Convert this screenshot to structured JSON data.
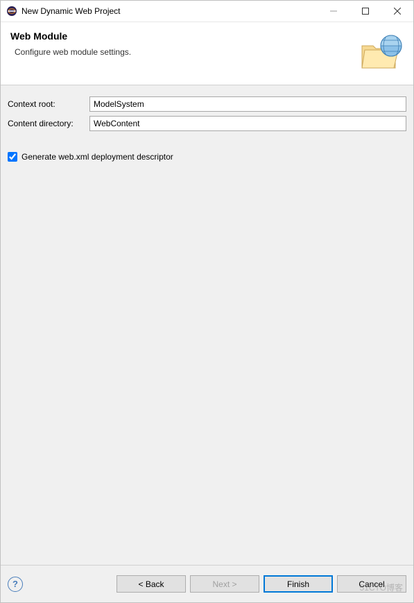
{
  "titlebar": {
    "title": "New Dynamic Web Project"
  },
  "header": {
    "title": "Web Module",
    "subtitle": "Configure web module settings."
  },
  "form": {
    "context_root_label": "Context root:",
    "context_root_value": "ModelSystem",
    "content_dir_label": "Content directory:",
    "content_dir_value": "WebContent",
    "generate_checkbox_label": "Generate web.xml deployment descriptor",
    "generate_checked": true
  },
  "footer": {
    "back": "< Back",
    "next": "Next >",
    "finish": "Finish",
    "cancel": "Cancel"
  },
  "watermark": "51CTO博客"
}
